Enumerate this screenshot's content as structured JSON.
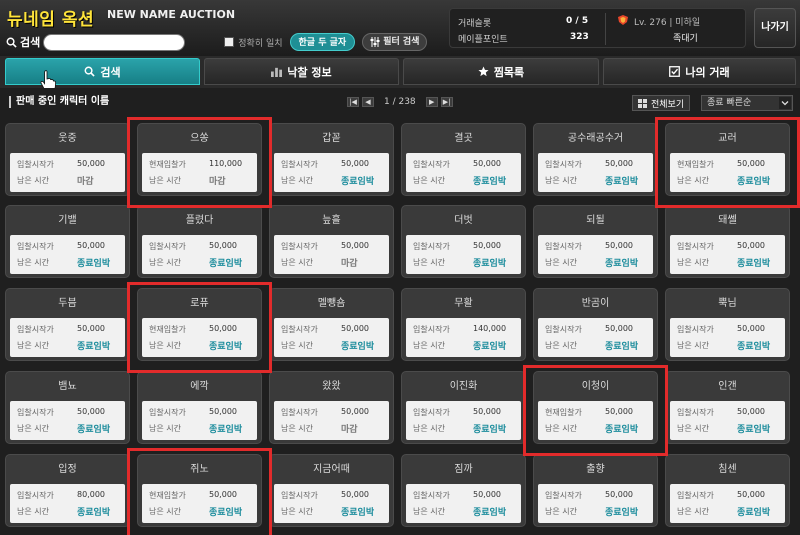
{
  "header": {
    "title": "뉴네임 옥션",
    "subtitle": "NEW NAME AUCTION",
    "search_label": "검색",
    "search_value": "",
    "exact_match_label": "정확히 일치",
    "hangul_button": "한글 두 글자",
    "filter_button": "필터 검색"
  },
  "info": {
    "trade_slot_label": "거래슬롯",
    "trade_slot_value": "0 / 5",
    "maple_point_label": "메이플포인트",
    "maple_point_value": "323",
    "level_text": "Lv. 276 | 미하일",
    "char_name": "족대기",
    "exit_button": "나가기"
  },
  "tabs": [
    {
      "label": "검색",
      "icon": "search-icon",
      "active": true
    },
    {
      "label": "낙찰 정보",
      "icon": "bar-chart-icon",
      "active": false
    },
    {
      "label": "찜목록",
      "icon": "star-icon",
      "active": false
    },
    {
      "label": "나의 거래",
      "icon": "checkbox-icon",
      "active": false
    }
  ],
  "list": {
    "title": "판매 중인 캐릭터 이름",
    "page_text": "1 / 238",
    "view_all": "전체보기",
    "sort_value": "종료 빠른순"
  },
  "cards": [
    {
      "name": "웃중",
      "price_label": "입찰시작가",
      "price": "50,000",
      "time_label": "남은 시간",
      "time": "마감",
      "status": "closed"
    },
    {
      "name": "으쏭",
      "price_label": "현재입찰가",
      "price": "110,000",
      "time_label": "남은 시간",
      "time": "마감",
      "status": "closed"
    },
    {
      "name": "갑꼳",
      "price_label": "입찰시작가",
      "price": "50,000",
      "time_label": "남은 시간",
      "time": "종료임박",
      "status": "ending"
    },
    {
      "name": "결곳",
      "price_label": "입찰시작가",
      "price": "50,000",
      "time_label": "남은 시간",
      "time": "종료임박",
      "status": "ending"
    },
    {
      "name": "공수래공수거",
      "price_label": "입찰시작가",
      "price": "50,000",
      "time_label": "남은 시간",
      "time": "종료임박",
      "status": "ending"
    },
    {
      "name": "교러",
      "price_label": "현재입찰가",
      "price": "50,000",
      "time_label": "남은 시간",
      "time": "종료임박",
      "status": "ending"
    },
    {
      "name": "기밸",
      "price_label": "입찰시작가",
      "price": "50,000",
      "time_label": "남은 시간",
      "time": "종료임박",
      "status": "ending"
    },
    {
      "name": "플렸다",
      "price_label": "입찰시작가",
      "price": "50,000",
      "time_label": "남은 시간",
      "time": "종료임박",
      "status": "ending"
    },
    {
      "name": "늪흘",
      "price_label": "입찰시작가",
      "price": "50,000",
      "time_label": "남은 시간",
      "time": "마감",
      "status": "closed"
    },
    {
      "name": "더벗",
      "price_label": "입찰시작가",
      "price": "50,000",
      "time_label": "남은 시간",
      "time": "종료임박",
      "status": "ending"
    },
    {
      "name": "되될",
      "price_label": "입찰시작가",
      "price": "50,000",
      "time_label": "남은 시간",
      "time": "종료임박",
      "status": "ending"
    },
    {
      "name": "돼쎌",
      "price_label": "입찰시작가",
      "price": "50,000",
      "time_label": "남은 시간",
      "time": "종료임박",
      "status": "ending"
    },
    {
      "name": "두븜",
      "price_label": "입찰시작가",
      "price": "50,000",
      "time_label": "남은 시간",
      "time": "종료임박",
      "status": "ending"
    },
    {
      "name": "로퓨",
      "price_label": "현재입찰가",
      "price": "50,000",
      "time_label": "남은 시간",
      "time": "종료임박",
      "status": "ending"
    },
    {
      "name": "멜뺑숌",
      "price_label": "입찰시작가",
      "price": "50,000",
      "time_label": "남은 시간",
      "time": "종료임박",
      "status": "ending"
    },
    {
      "name": "무활",
      "price_label": "입찰시작가",
      "price": "140,000",
      "time_label": "남은 시간",
      "time": "종료임박",
      "status": "ending"
    },
    {
      "name": "반곰이",
      "price_label": "입찰시작가",
      "price": "50,000",
      "time_label": "남은 시간",
      "time": "종료임박",
      "status": "ending"
    },
    {
      "name": "뿍님",
      "price_label": "입찰시작가",
      "price": "50,000",
      "time_label": "남은 시간",
      "time": "종료임박",
      "status": "ending"
    },
    {
      "name": "뱀뇨",
      "price_label": "입찰시작가",
      "price": "50,000",
      "time_label": "남은 시간",
      "time": "종료임박",
      "status": "ending"
    },
    {
      "name": "에깍",
      "price_label": "입찰시작가",
      "price": "50,000",
      "time_label": "남은 시간",
      "time": "종료임박",
      "status": "ending"
    },
    {
      "name": "왔왔",
      "price_label": "입찰시작가",
      "price": "50,000",
      "time_label": "남은 시간",
      "time": "마감",
      "status": "closed"
    },
    {
      "name": "이진화",
      "price_label": "입찰시작가",
      "price": "50,000",
      "time_label": "남은 시간",
      "time": "종료임박",
      "status": "ending"
    },
    {
      "name": "이청이",
      "price_label": "현재입찰가",
      "price": "50,000",
      "time_label": "남은 시간",
      "time": "종료임박",
      "status": "ending"
    },
    {
      "name": "인갠",
      "price_label": "입찰시작가",
      "price": "50,000",
      "time_label": "남은 시간",
      "time": "종료임박",
      "status": "ending"
    },
    {
      "name": "입정",
      "price_label": "입찰시작가",
      "price": "80,000",
      "time_label": "남은 시간",
      "time": "종료임박",
      "status": "ending"
    },
    {
      "name": "쥐노",
      "price_label": "현재입찰가",
      "price": "50,000",
      "time_label": "남은 시간",
      "time": "종료임박",
      "status": "ending"
    },
    {
      "name": "지금어때",
      "price_label": "입찰시작가",
      "price": "50,000",
      "time_label": "남은 시간",
      "time": "종료임박",
      "status": "ending"
    },
    {
      "name": "짐까",
      "price_label": "입찰시작가",
      "price": "50,000",
      "time_label": "남은 시간",
      "time": "종료임박",
      "status": "ending"
    },
    {
      "name": "출향",
      "price_label": "입찰시작가",
      "price": "50,000",
      "time_label": "남은 시간",
      "time": "종료임박",
      "status": "ending"
    },
    {
      "name": "침센",
      "price_label": "입찰시작가",
      "price": "50,000",
      "time_label": "남은 시간",
      "time": "종료임박",
      "status": "ending"
    }
  ],
  "highlighted_cards": [
    1,
    5,
    13,
    22,
    25
  ],
  "colors": {
    "accent": "#1f8f95",
    "title": "#ffe43a",
    "ending_text": "#1b8c9c",
    "highlight": "#e22b2b"
  }
}
